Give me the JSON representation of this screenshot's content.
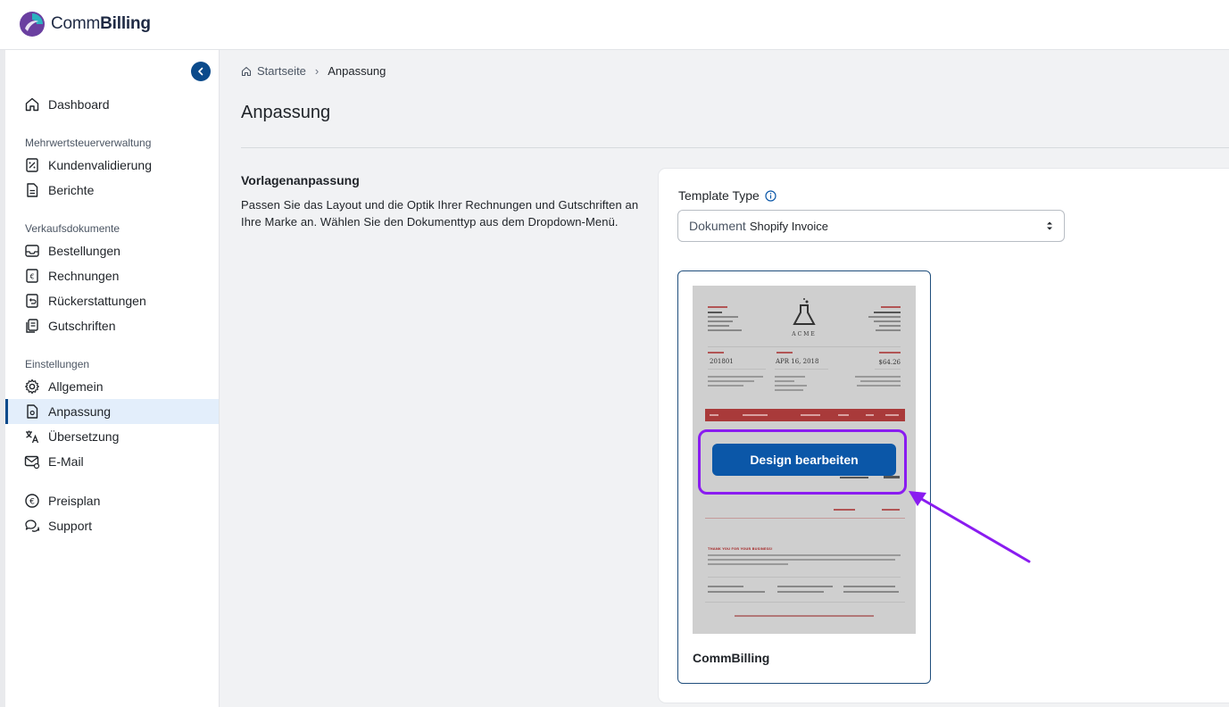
{
  "app": {
    "logo_text_a": "Comm",
    "logo_text_b": "Billing"
  },
  "sidebar": {
    "dashboard": "Dashboard",
    "section_vat": "Mehrwertsteuerverwaltung",
    "kundenvalidierung": "Kundenvalidierung",
    "berichte": "Berichte",
    "section_sales": "Verkaufsdokumente",
    "bestellungen": "Bestellungen",
    "rechnungen": "Rechnungen",
    "rueckerstattungen": "Rückerstattungen",
    "gutschriften": "Gutschriften",
    "section_settings": "Einstellungen",
    "allgemein": "Allgemein",
    "anpassung": "Anpassung",
    "uebersetzung": "Übersetzung",
    "email": "E-Mail",
    "preisplan": "Preisplan",
    "support": "Support"
  },
  "breadcrumb": {
    "home": "Startseite",
    "current": "Anpassung"
  },
  "page": {
    "title": "Anpassung",
    "section_title": "Vorlagenanpassung",
    "section_desc": "Passen Sie das Layout und die Optik Ihrer Rechnungen und Gutschriften an Ihre Marke an. Wählen Sie den Dokumenttyp aus dem Dropdown-Menü."
  },
  "template": {
    "type_label": "Template Type",
    "select_prefix": "Dokument",
    "select_value": "Shopify Invoice",
    "design_button": "Design bearbeiten",
    "template_name": "CommBilling"
  },
  "invoice_preview": {
    "brand": "ACME",
    "invoice_no": "201801",
    "date": "APR 16, 2018",
    "amount": "$64.26",
    "thanks": "THANK YOU FOR YOUR BUSINESS!"
  },
  "colors": {
    "accent": "#0b4a8b",
    "button": "#0b57a8",
    "highlight": "#8a1cf0",
    "active_bg": "#e3eefb"
  }
}
